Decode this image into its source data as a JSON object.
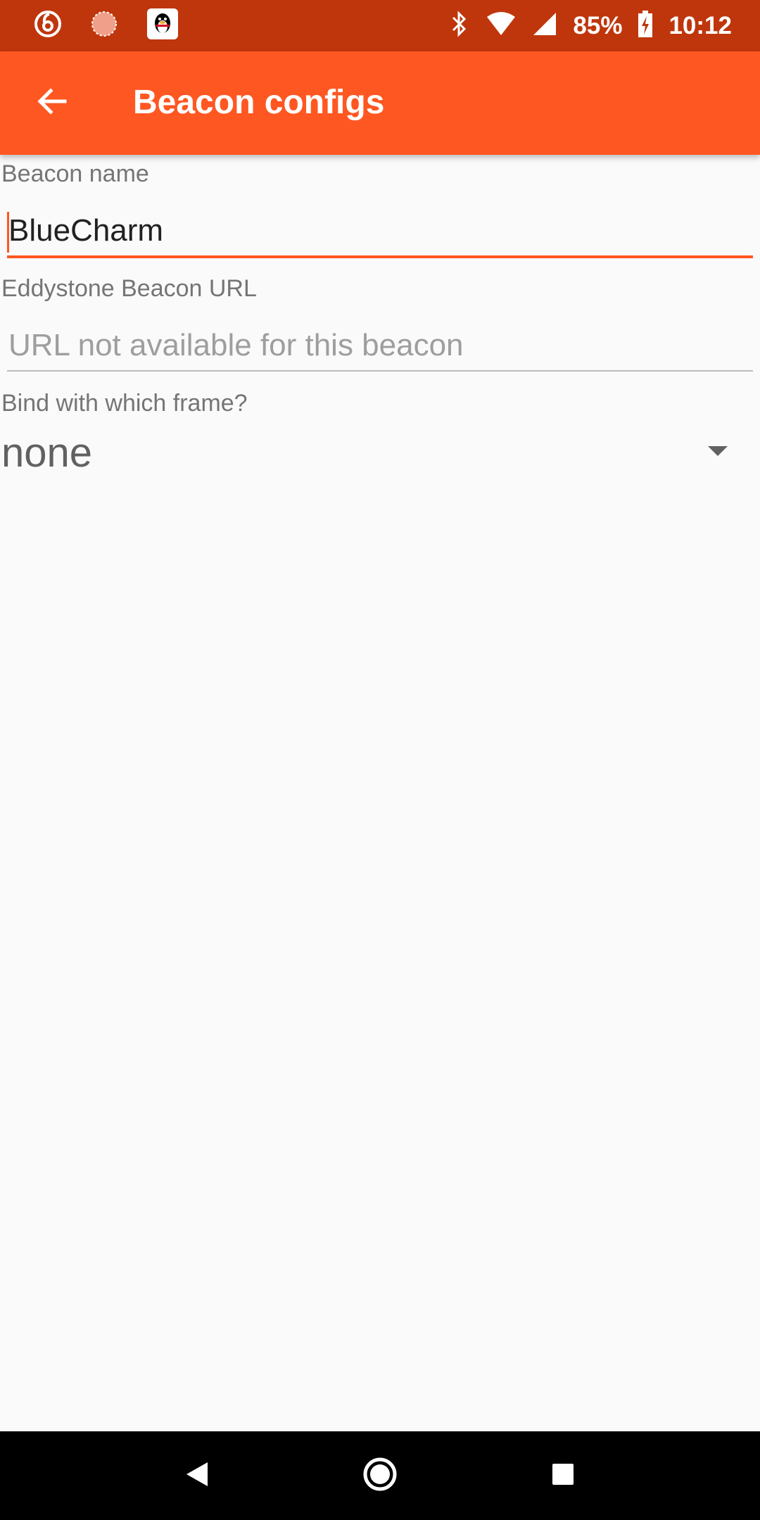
{
  "status_bar": {
    "battery": "85%",
    "time": "10:12",
    "icons": [
      "netease-music-icon",
      "loading-circle-icon",
      "qq-penguin-icon",
      "bluetooth-icon",
      "wifi-icon",
      "cell-signal-icon",
      "battery-charging-icon"
    ]
  },
  "app_bar": {
    "title": "Beacon configs",
    "back_icon": "arrow-back-icon",
    "color": "#ff5722"
  },
  "form": {
    "beacon_name": {
      "label": "Beacon name",
      "value": "BlueCharm"
    },
    "eddystone_url": {
      "label": "Eddystone Beacon URL",
      "placeholder": "URL not available for this beacon",
      "value": ""
    },
    "bind_frame": {
      "label": "Bind with which frame?",
      "selected": "none"
    }
  },
  "nav_bar": {
    "icons": [
      "nav-back-icon",
      "nav-home-icon",
      "nav-recents-icon"
    ]
  },
  "colors": {
    "status_bar": "#bf360c",
    "accent": "#ff5722",
    "background": "#fafafa"
  }
}
